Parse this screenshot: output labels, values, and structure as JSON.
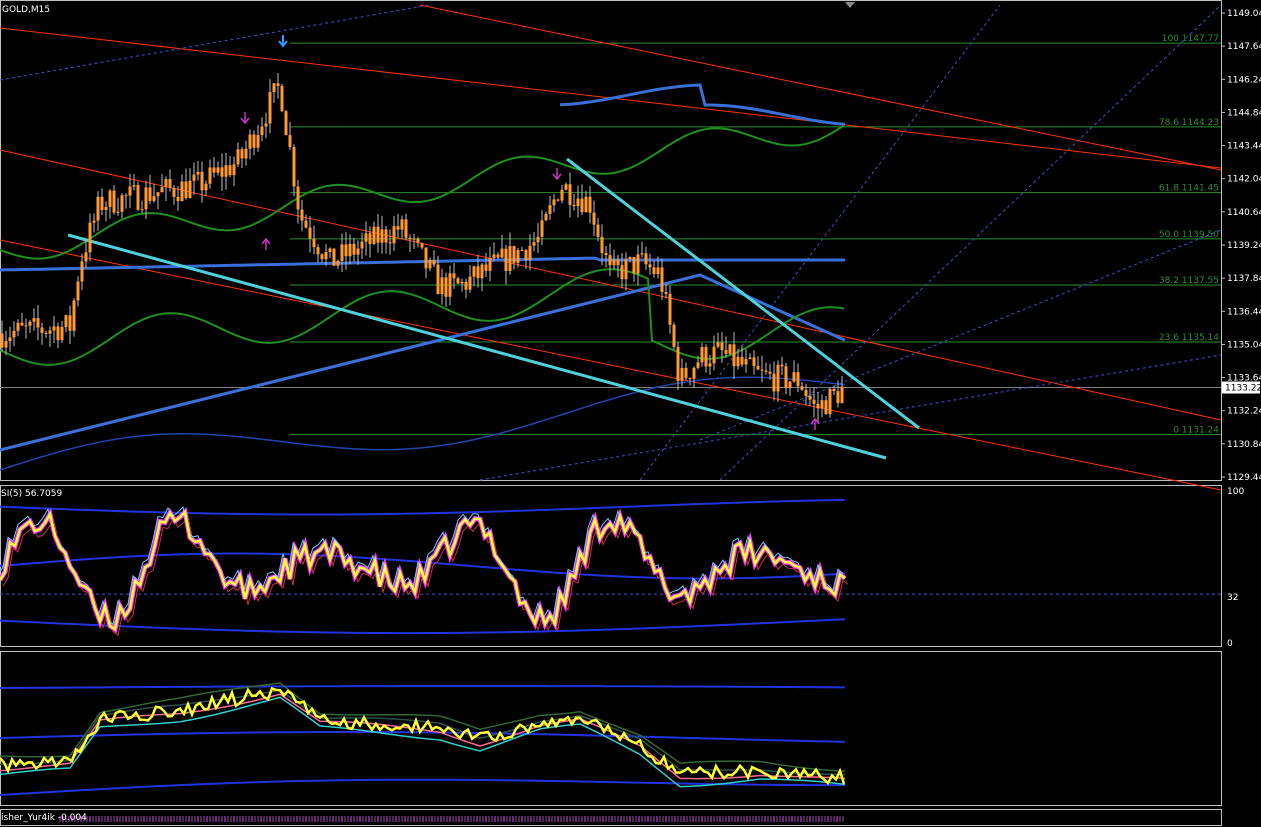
{
  "symbol_label": "GOLD,M15",
  "price_axis": {
    "ticks": [
      "1149.04",
      "1147.64",
      "1146.24",
      "1144.84",
      "1143.44",
      "1142.04",
      "1140.64",
      "1139.24",
      "1137.84",
      "1136.44",
      "1135.04",
      "1133.64",
      "1132.24",
      "1130.84",
      "1129.44"
    ],
    "current_price": "1133.22"
  },
  "fib_levels": [
    {
      "label": "100 1147.77",
      "price": 1147.77
    },
    {
      "label": "78.6 1144.23",
      "price": 1144.23
    },
    {
      "label": "61.8 1141.45",
      "price": 1141.45
    },
    {
      "label": "50.0 1139.50",
      "price": 1139.5
    },
    {
      "label": "38.2 1137.55",
      "price": 1137.55
    },
    {
      "label": "23.6 1135.14",
      "price": 1135.14
    },
    {
      "label": "0 1131.24",
      "price": 1131.24
    }
  ],
  "rsi_panel": {
    "label": "SI(5) 56.7059",
    "ticks": [
      "100",
      "32",
      "0"
    ],
    "current_value": 56.7059
  },
  "fisher_panel": {
    "label": "isher_Yur4ik -0.004"
  },
  "colors": {
    "background": "#000000",
    "bull_candle": "#ff9933",
    "bear_candle": "#ff9933",
    "channel": "#ff3300",
    "trendline": "#4fd1d9",
    "bollinger_blue": "#3a6fd8",
    "bollinger_green": "#1f8f1f",
    "rsi_line": "#ffff33",
    "rsi_fill": "#ff33ff",
    "fib": "#2e8b2e",
    "axis_text": "#ffffff"
  },
  "icons": [
    "down-arrow-icon",
    "up-arrow-icon",
    "scroll-marker-icon"
  ]
}
